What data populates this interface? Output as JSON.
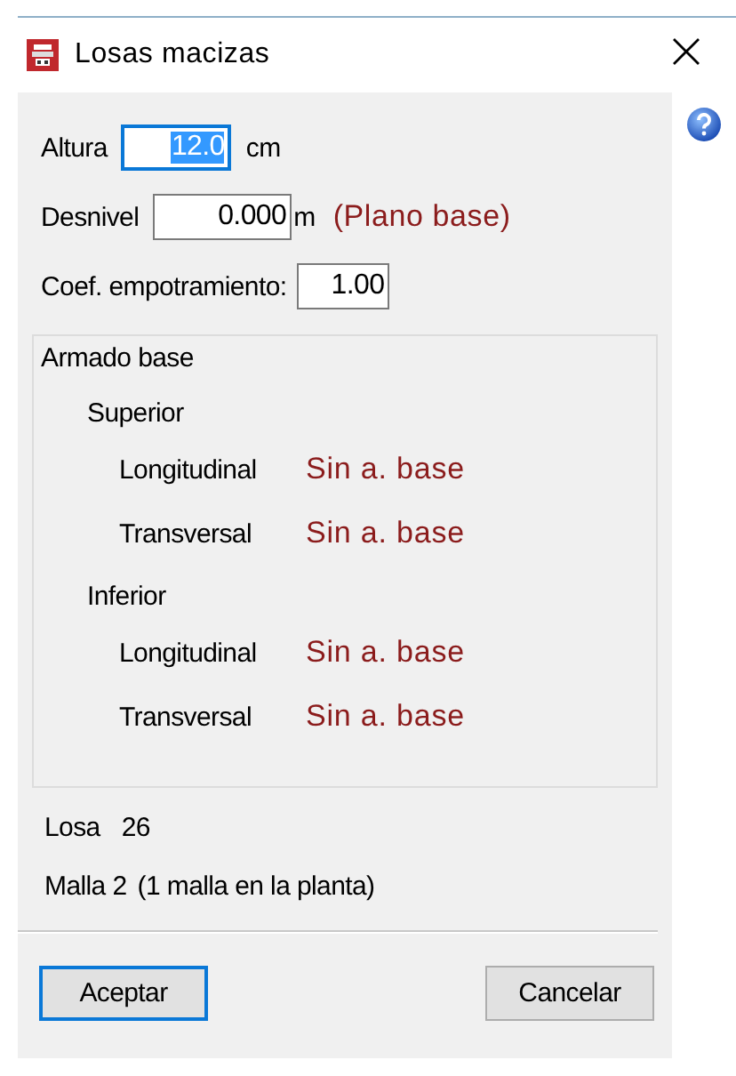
{
  "window": {
    "title": "Losas macizas"
  },
  "fields": [
    {
      "label": "Altura",
      "value": "12.0",
      "unit": "cm",
      "selected": true
    },
    {
      "label": "Desnivel",
      "value": "0.000",
      "unit": "m",
      "note": "(Plano base)",
      "selected": false
    },
    {
      "label": "Coef. empotramiento:",
      "value": "1.00",
      "selected": false
    }
  ],
  "armado": {
    "title": "Armado base",
    "groups": [
      {
        "title": "Superior",
        "rows": [
          {
            "label": "Longitudinal",
            "value": "Sin a. base"
          },
          {
            "label": "Transversal",
            "value": "Sin a. base"
          }
        ]
      },
      {
        "title": "Inferior",
        "rows": [
          {
            "label": "Longitudinal",
            "value": "Sin a. base"
          },
          {
            "label": "Transversal",
            "value": "Sin a. base"
          }
        ]
      }
    ]
  },
  "info": [
    {
      "label": "Losa",
      "value": "26"
    },
    {
      "label": "Malla 2",
      "value": "(1 malla en la planta)"
    }
  ],
  "buttons": [
    {
      "label": "Aceptar",
      "default": true
    },
    {
      "label": "Cancelar",
      "default": false
    }
  ]
}
